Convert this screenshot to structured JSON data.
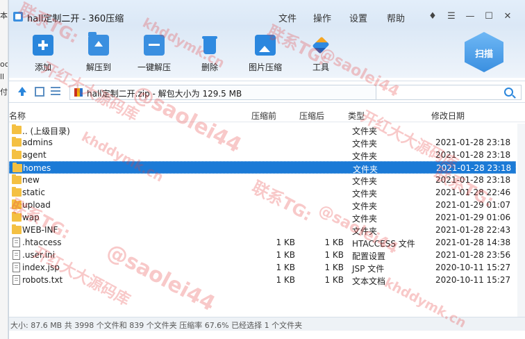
{
  "window": {
    "title": "hall定制二开 - 360压缩",
    "menu": [
      "文件",
      "操作",
      "设置",
      "帮助"
    ],
    "controls": {
      "skin": "♦",
      "feedback": "☰",
      "minimize": "—",
      "maximize": "☐",
      "close": "✕"
    }
  },
  "left_strip": [
    "本",
    "oc",
    "ll",
    "付"
  ],
  "toolbar": {
    "add": "添加",
    "extract_to": "解压到",
    "one_click_extract": "一键解压",
    "delete": "删除",
    "image_compress": "图片压缩",
    "tools": "工具",
    "scan": "扫描"
  },
  "address": {
    "path": "hall定制二开.zip - 解包大小为 129.5 MB",
    "search_value": ""
  },
  "columns": {
    "name": "名称",
    "compressed_before": "压缩前",
    "compressed_after": "压缩后",
    "type": "类型",
    "modified": "修改日期"
  },
  "files": [
    {
      "icon": "folder-icon",
      "name": ".. (上级目录)",
      "before": "",
      "after": "",
      "type": "文件夹",
      "date": ""
    },
    {
      "icon": "folder-icon",
      "name": "admins",
      "before": "",
      "after": "",
      "type": "文件夹",
      "date": "2021-01-28 23:18"
    },
    {
      "icon": "folder-icon",
      "name": "agent",
      "before": "",
      "after": "",
      "type": "文件夹",
      "date": "2021-01-28 23:18"
    },
    {
      "icon": "folder-icon",
      "name": "homes",
      "before": "",
      "after": "",
      "type": "文件夹",
      "date": "2021-01-28 23:18",
      "selected": true
    },
    {
      "icon": "folder-icon",
      "name": "new",
      "before": "",
      "after": "",
      "type": "文件夹",
      "date": "2021-01-28 23:18"
    },
    {
      "icon": "folder-icon",
      "name": "static",
      "before": "",
      "after": "",
      "type": "文件夹",
      "date": "2021-01-28 22:46"
    },
    {
      "icon": "folder-icon",
      "name": "upload",
      "before": "",
      "after": "",
      "type": "文件夹",
      "date": "2021-01-29 01:07"
    },
    {
      "icon": "folder-icon",
      "name": "wap",
      "before": "",
      "after": "",
      "type": "文件夹",
      "date": "2021-01-29 01:06"
    },
    {
      "icon": "folder-icon",
      "name": "WEB-INF",
      "before": "",
      "after": "",
      "type": "文件夹",
      "date": "2021-01-28 22:43"
    },
    {
      "icon": "document-icon",
      "name": ".htaccess",
      "before": "1 KB",
      "after": "1 KB",
      "type": "HTACCESS 文件",
      "date": "2021-01-28 14:38"
    },
    {
      "icon": "document-icon",
      "name": ".user.ini",
      "before": "1 KB",
      "after": "1 KB",
      "type": "配置设置",
      "date": "2021-01-28 23:56"
    },
    {
      "icon": "document-icon",
      "name": "index.jsp",
      "before": "1 KB",
      "after": "1 KB",
      "type": "JSP 文件",
      "date": "2020-10-11 15:27"
    },
    {
      "icon": "document-icon",
      "name": "robots.txt",
      "before": "1 KB",
      "after": "1 KB",
      "type": "文本文档",
      "date": "2020-10-11 15:27"
    }
  ],
  "status": "大小: 87.6 MB 共 3998 个文件和 839 个文件夹 压缩率 67.6% 已经选择 1 个文件夹",
  "watermark": {
    "texts": [
      "联系TG:",
      "@saolei44",
      "开红大大源码库",
      "khddymk.cn"
    ],
    "color": "#e63c3c"
  },
  "colors": {
    "selection": "#1b7ad6",
    "accent": "#2a86dc",
    "folder": "#f4c042"
  }
}
